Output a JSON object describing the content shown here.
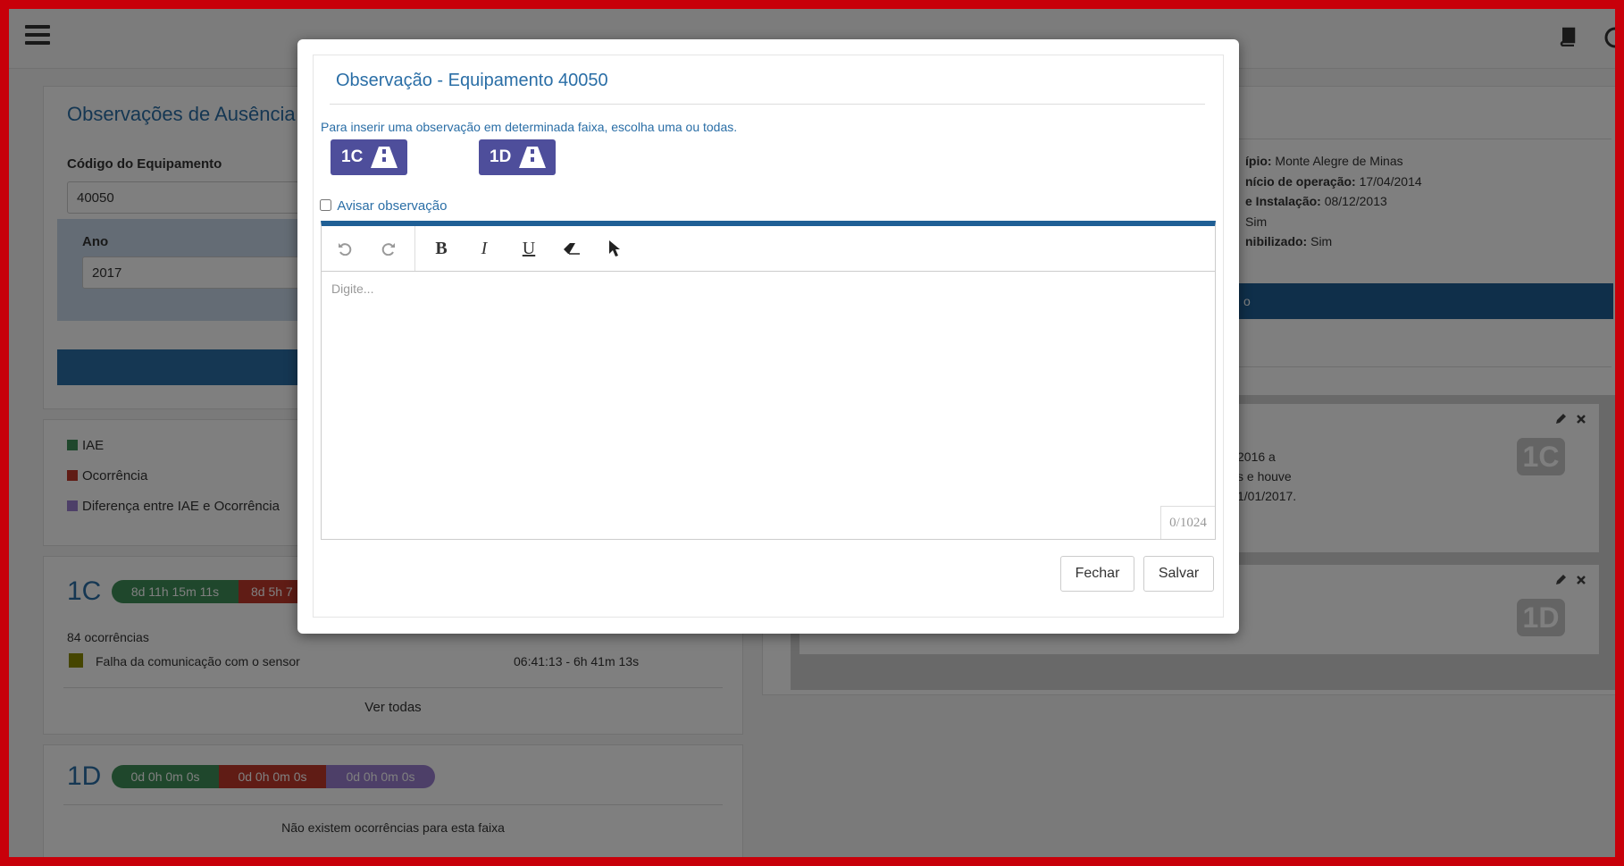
{
  "colors": {
    "frame": "#c8000a",
    "accent": "#2a6ea6",
    "lane_button": "#4e4e9b",
    "iae": "#3f8f58",
    "ocorrencia": "#c0392b",
    "diferenca": "#9b7fd0",
    "falha": "#8a8a00"
  },
  "background": {
    "left_title": "Observações de Ausência d",
    "codigo_label": "Código do Equipamento",
    "codigo_value": "40050",
    "ano_label": "Ano",
    "ano_value": "2017",
    "legend": [
      {
        "label": "IAE"
      },
      {
        "label": "Ocorrência"
      },
      {
        "label": "Diferença entre IAE e Ocorrência"
      }
    ],
    "lane_1c": {
      "name": "1C",
      "pill_iae": "8d 11h 15m 11s",
      "pill_oc": "8d 5h 7",
      "count": "84 ocorrências",
      "item_label": "Falha da comunicação com o sensor",
      "item_time": "06:41:13 - 6h 41m 13s",
      "see_all": "Ver todas"
    },
    "lane_1d": {
      "name": "1D",
      "pill_iae": "0d 0h 0m 0s",
      "pill_oc": "0d 0h 0m 0s",
      "pill_dif": "0d 0h 0m 0s",
      "empty": "Não existem ocorrências para esta faixa"
    },
    "info": [
      {
        "key": "ípio:",
        "value": " Monte Alegre de Minas"
      },
      {
        "key": "nício de operação:",
        "value": " 17/04/2014"
      },
      {
        "key": "e Instalação:",
        "value": " 08/12/2013"
      },
      {
        "key": "",
        "value": " Sim"
      },
      {
        "key": "nibilizado:",
        "value": " Sim"
      }
    ],
    "right_bar_text": "o",
    "obs_card": {
      "lines": [
        "2016 a",
        "s e houve",
        "1/01/2017."
      ],
      "badge": "1C"
    },
    "obs_card2": {
      "badge": "1D"
    }
  },
  "modal": {
    "title": "Observação - Equipamento 40050",
    "hint": "Para inserir uma observação em determinada faixa, escolha uma ou todas.",
    "lane_buttons": [
      {
        "label": "1C"
      },
      {
        "label": "1D"
      }
    ],
    "notify_label": "Avisar observação",
    "notify_checked": false,
    "toolbar": {
      "undo_icon": "undo-icon",
      "redo_icon": "redo-icon",
      "bold": "B",
      "italic": "I",
      "underline": "U",
      "eraser_icon": "eraser-icon",
      "cursor_icon": "cursor-icon"
    },
    "editor_placeholder": "Digite...",
    "char_counter": "0/1024",
    "close_label": "Fechar",
    "save_label": "Salvar"
  }
}
